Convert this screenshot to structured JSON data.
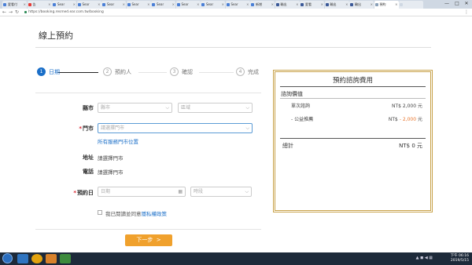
{
  "browser": {
    "tabs": [
      {
        "title": "愛看付",
        "color": "#4a7fd6"
      },
      {
        "title": "告",
        "color": "#e53935"
      },
      {
        "title": "Sear",
        "color": "#4a7fd6"
      },
      {
        "title": "Sear",
        "color": "#4a7fd6"
      },
      {
        "title": "Sear",
        "color": "#4a7fd6"
      },
      {
        "title": "Sear",
        "color": "#4a7fd6"
      },
      {
        "title": "Sear",
        "color": "#4a7fd6"
      },
      {
        "title": "Sear",
        "color": "#4a7fd6"
      },
      {
        "title": "Sear",
        "color": "#4a7fd6"
      },
      {
        "title": "Sear",
        "color": "#4a7fd6"
      },
      {
        "title": "新增",
        "color": "#4a7fd6"
      },
      {
        "title": "輸出",
        "color": "#3b5998"
      },
      {
        "title": "愛看",
        "color": "#3b5998"
      },
      {
        "title": "輸出",
        "color": "#3b5998"
      },
      {
        "title": "輸出",
        "color": "#3b5998"
      },
      {
        "title": "預約",
        "color": "#8aa0b8",
        "active": true
      },
      {
        "title": "",
        "color": "#cfd8e3"
      }
    ],
    "url": "https://booking.resmed.ear.com.tw/booking",
    "window_controls": {
      "min": "—",
      "max": "□",
      "close": "✕"
    },
    "nav_icons": {
      "back": "←",
      "forward": "→",
      "reload": "↻",
      "menu": "⋮"
    }
  },
  "page": {
    "title": "線上預約",
    "steps": [
      {
        "num": "1",
        "label": "日期",
        "active": true
      },
      {
        "num": "2",
        "label": "預約人",
        "active": false
      },
      {
        "num": "3",
        "label": "確認",
        "active": false
      },
      {
        "num": "4",
        "label": "完成",
        "active": false
      }
    ]
  },
  "form": {
    "city_label": "縣市",
    "city_placeholder": "縣市",
    "district_placeholder": "區域",
    "store_required": "*",
    "store_label": "門市",
    "store_placeholder": "請選擇門市",
    "store_link": "所有服務門市位置",
    "address_label": "地址",
    "address_value": "請選擇門市",
    "phone_label": "電話",
    "phone_value": "請選擇門市",
    "date_required": "*",
    "date_label": "預約日",
    "date_placeholder": "日期",
    "time_placeholder": "時段",
    "consent_prefix": "我已閱讀並同意",
    "consent_link": "隱私權政策",
    "next_button": "下一步",
    "next_arrow": ">"
  },
  "panel": {
    "title": "預約諮詢費用",
    "subtitle": "諮詢價值",
    "rows": [
      {
        "label": "單次諮詢",
        "currency": "NT$",
        "amount": "2,000",
        "unit": "元",
        "orange": false
      },
      {
        "label": "- 公益推薦",
        "currency": "NT$",
        "amount": "- 2,000",
        "unit": "元",
        "orange": true
      }
    ],
    "total_label": "總計",
    "total_value": "NT$ 0 元"
  },
  "taskbar": {
    "tray_text": "▲ ◼ ◀ ▦",
    "time": "下午 06:16",
    "date": "2019/5/15"
  },
  "colors": {
    "accent": "#1b6fc8",
    "button": "#f0a12d",
    "panel_border": "#c8a24a",
    "required": "#d9232d",
    "discount": "#e8762d"
  }
}
